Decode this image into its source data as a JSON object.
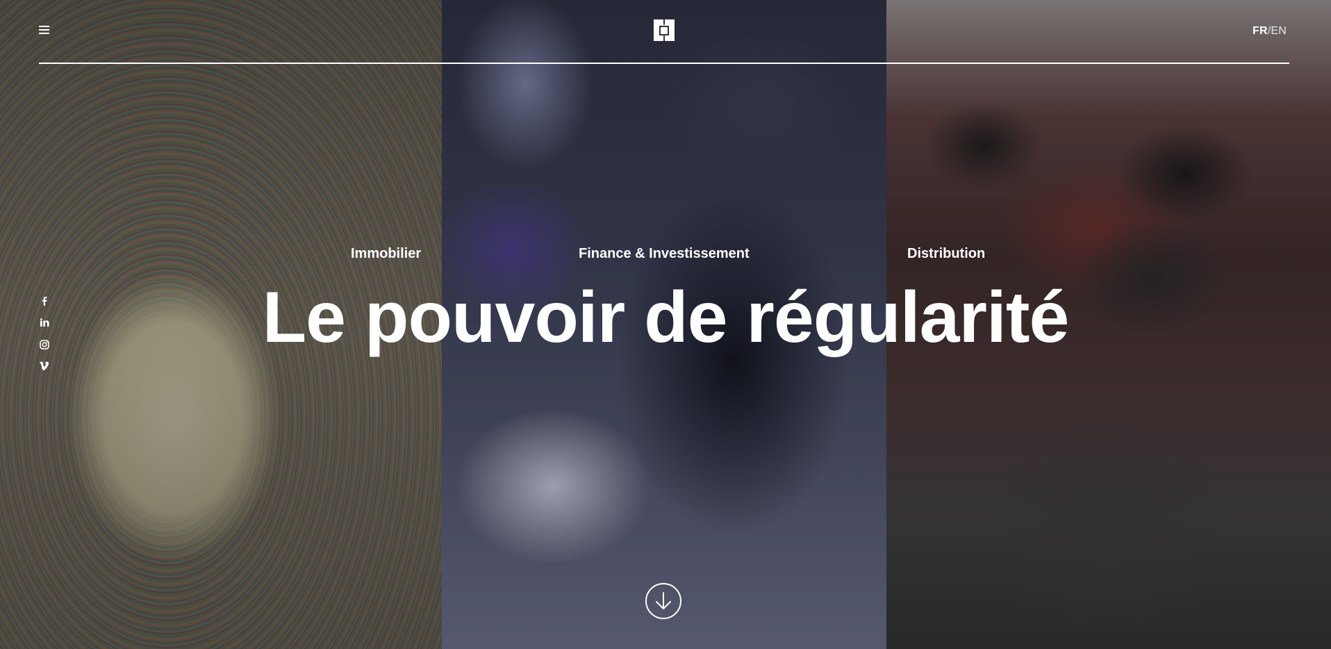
{
  "header": {
    "menu_icon": "hamburger-menu-icon",
    "logo_icon": "brand-logo-icon",
    "lang_fr": "FR",
    "lang_sep": "/",
    "lang_en": "EN"
  },
  "social": [
    {
      "name": "facebook-icon",
      "glyph": "f"
    },
    {
      "name": "linkedin-icon",
      "glyph": "in"
    },
    {
      "name": "instagram-icon",
      "glyph": ""
    },
    {
      "name": "vimeo-icon",
      "glyph": ""
    }
  ],
  "categories": [
    {
      "label": "Immobilier"
    },
    {
      "label": "Finance & Investissement"
    },
    {
      "label": "Distribution"
    }
  ],
  "hero": {
    "title": "Le pouvoir de régularité"
  },
  "scroll": {
    "icon": "arrow-down-icon"
  }
}
